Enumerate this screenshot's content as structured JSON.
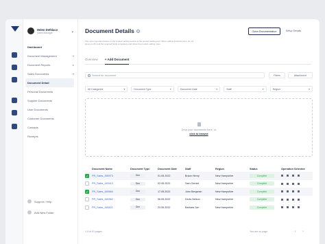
{
  "user": {
    "name": "Helen Dethlaco",
    "role": "Sales Manager"
  },
  "nav": {
    "dashboard": "Dashboard",
    "items": [
      {
        "label": "Document Management",
        "caret": "▾"
      },
      {
        "label": "Document Reports",
        "caret": "▸"
      },
      {
        "label": "Sales Documents",
        "caret": "▾"
      },
      {
        "label": "Document Detail",
        "caret": ""
      },
      {
        "label": "Personal Documents",
        "caret": ""
      },
      {
        "label": "Supplier Documents",
        "caret": ""
      },
      {
        "label": "User Documents",
        "caret": ""
      },
      {
        "label": "Customer Documents",
        "caret": ""
      },
      {
        "label": "Contacts",
        "caret": ""
      },
      {
        "label": "Receipts",
        "caret": ""
      }
    ],
    "support": "Support / Help",
    "add_folder": "Add New Folder"
  },
  "header": {
    "title": "Document Details",
    "open_doc": "Open Documentation",
    "setup": "Setup Details",
    "description": "The most important feature in the product editing section is the product adding part. When adding products here, do not ignore to fill in all the required fields completely and follow the product adding rules."
  },
  "tabs": [
    "Overview",
    "+ Add Document"
  ],
  "search": {
    "placeholder": "Search for document"
  },
  "buttons": {
    "filters": "Filters",
    "attachment": "Attachment"
  },
  "filters": [
    "All Categories",
    "Document Type",
    "Document Date",
    "Staff",
    "Region"
  ],
  "dropzone": {
    "text": "Drop your documents here, or",
    "link": "click to browse"
  },
  "table": {
    "headers": [
      "Document Name",
      "Document Type",
      "Document Date",
      "Staff",
      "Region",
      "Status",
      "Operation Selected"
    ],
    "rows": [
      {
        "checked": true,
        "name": "PR_Sales_455973",
        "type": "Doc",
        "date": "01.05.2022",
        "staff": "Braun Henry",
        "region": "New Hampshire",
        "status": "Complete"
      },
      {
        "checked": false,
        "name": "PR_Sales_449413",
        "type": "Doc",
        "date": "02.05.2022",
        "staff": "Sam Gemini",
        "region": "New Hampshire",
        "status": "Complete"
      },
      {
        "checked": true,
        "name": "PR_Sales_445684",
        "type": "Doc",
        "date": "17.05.2022",
        "staff": "John Benjamin",
        "region": "New Hampshire",
        "status": "Complete"
      },
      {
        "checked": false,
        "name": "PR_Sales_445962",
        "type": "Doc",
        "date": "06.05.2022",
        "staff": "Devis Nelson",
        "region": "New Hampshire",
        "status": "Complete"
      },
      {
        "checked": false,
        "name": "PR_Sales_445621",
        "type": "Doc",
        "date": "23.05.2022",
        "staff": "Barbara Joe",
        "region": "New Hampshire",
        "status": "Complete"
      }
    ]
  },
  "footer": {
    "count": "1-5 of 91 pages",
    "per_page": "You are on page",
    "pager": "‹ ›"
  },
  "colors": {
    "accent": "#1f2a44",
    "status_green": "#2fa84f",
    "link_blue": "#3b6bd6"
  }
}
